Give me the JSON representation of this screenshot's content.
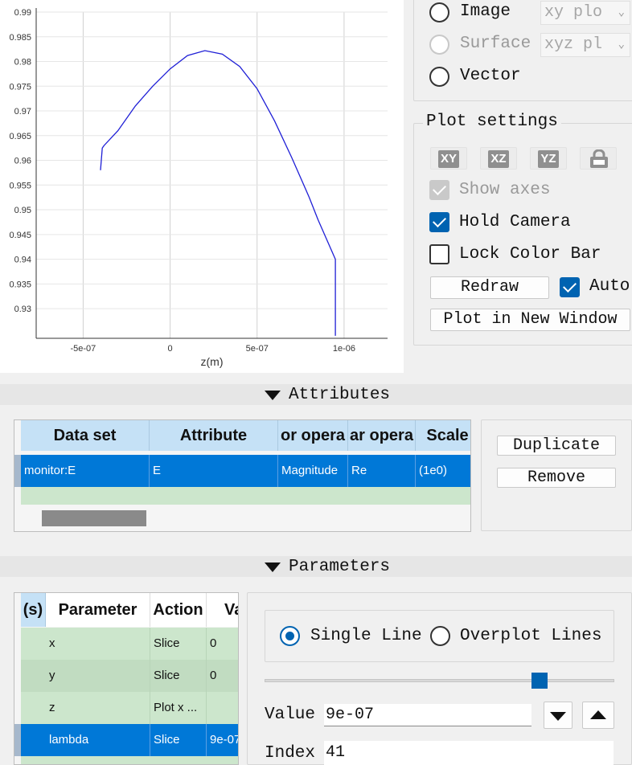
{
  "plot": {
    "xlabel": "z(m)",
    "x_ticks": [
      "-5e-07",
      "0",
      "5e-07",
      "1e-06"
    ],
    "y_ticks": [
      "0.99",
      "0.985",
      "0.98",
      "0.975",
      "0.97",
      "0.965",
      "0.96",
      "0.955",
      "0.95",
      "0.945",
      "0.94",
      "0.935",
      "0.93"
    ],
    "line_color": "#1f1fd6"
  },
  "chart_data": {
    "type": "line",
    "xlabel": "z(m)",
    "ylabel": "",
    "xlim": [
      -7.7e-07,
      1.25e-06
    ],
    "ylim": [
      0.924,
      0.99
    ],
    "x": [
      -4e-07,
      -3.9e-07,
      -3.8e-07,
      -3e-07,
      -2e-07,
      -1e-07,
      0,
      1e-07,
      2e-07,
      3e-07,
      4e-07,
      5e-07,
      6e-07,
      7e-07,
      8e-07,
      8.5e-07,
      9e-07,
      9.5e-07,
      9.5e-07
    ],
    "series": [
      {
        "values": [
          0.958,
          0.9625,
          0.963,
          0.966,
          0.971,
          0.975,
          0.9785,
          0.9812,
          0.9822,
          0.9815,
          0.979,
          0.9745,
          0.968,
          0.9605,
          0.9525,
          0.948,
          0.944,
          0.94,
          0.9245
        ]
      }
    ]
  },
  "view_options": {
    "items": [
      {
        "label": "Image",
        "state": "unchecked",
        "combo": "xy plo"
      },
      {
        "label": "Surface",
        "state": "disabled",
        "combo": "xyz pl"
      },
      {
        "label": "Vector",
        "state": "unchecked"
      }
    ]
  },
  "plot_settings": {
    "title": "Plot settings",
    "icons": [
      "XY",
      "XZ",
      "YZ"
    ],
    "show_axes": "Show axes",
    "hold_camera": "Hold Camera",
    "lock_color_bar": "Lock Color Bar",
    "redraw": "Redraw",
    "auto": "Auto",
    "plot_new_window": "Plot in New Window"
  },
  "attributes": {
    "title": "Attributes",
    "headers": [
      "Data set",
      "Attribute",
      "or opera",
      "ar opera",
      "Scale"
    ],
    "rows": [
      [
        "monitor:E",
        "E",
        "Magnitude",
        "Re",
        "(1e0)"
      ]
    ],
    "duplicate": "Duplicate",
    "remove": "Remove"
  },
  "parameters": {
    "title": "Parameters",
    "headers": [
      "(s)",
      "Parameter",
      "Action",
      "Va"
    ],
    "rows": [
      [
        "",
        "x",
        "Slice",
        "0"
      ],
      [
        "",
        "y",
        "Slice",
        "0"
      ],
      [
        "",
        "z",
        "Plot x ...",
        ""
      ],
      [
        "",
        "lambda",
        "Slice",
        "9e-07"
      ]
    ],
    "single_line": "Single Line",
    "overplot_lines": "Overplot Lines",
    "value_label": "Value",
    "value": "9e-07",
    "index_label": "Index",
    "index": "41",
    "accent": "#0063b1"
  }
}
